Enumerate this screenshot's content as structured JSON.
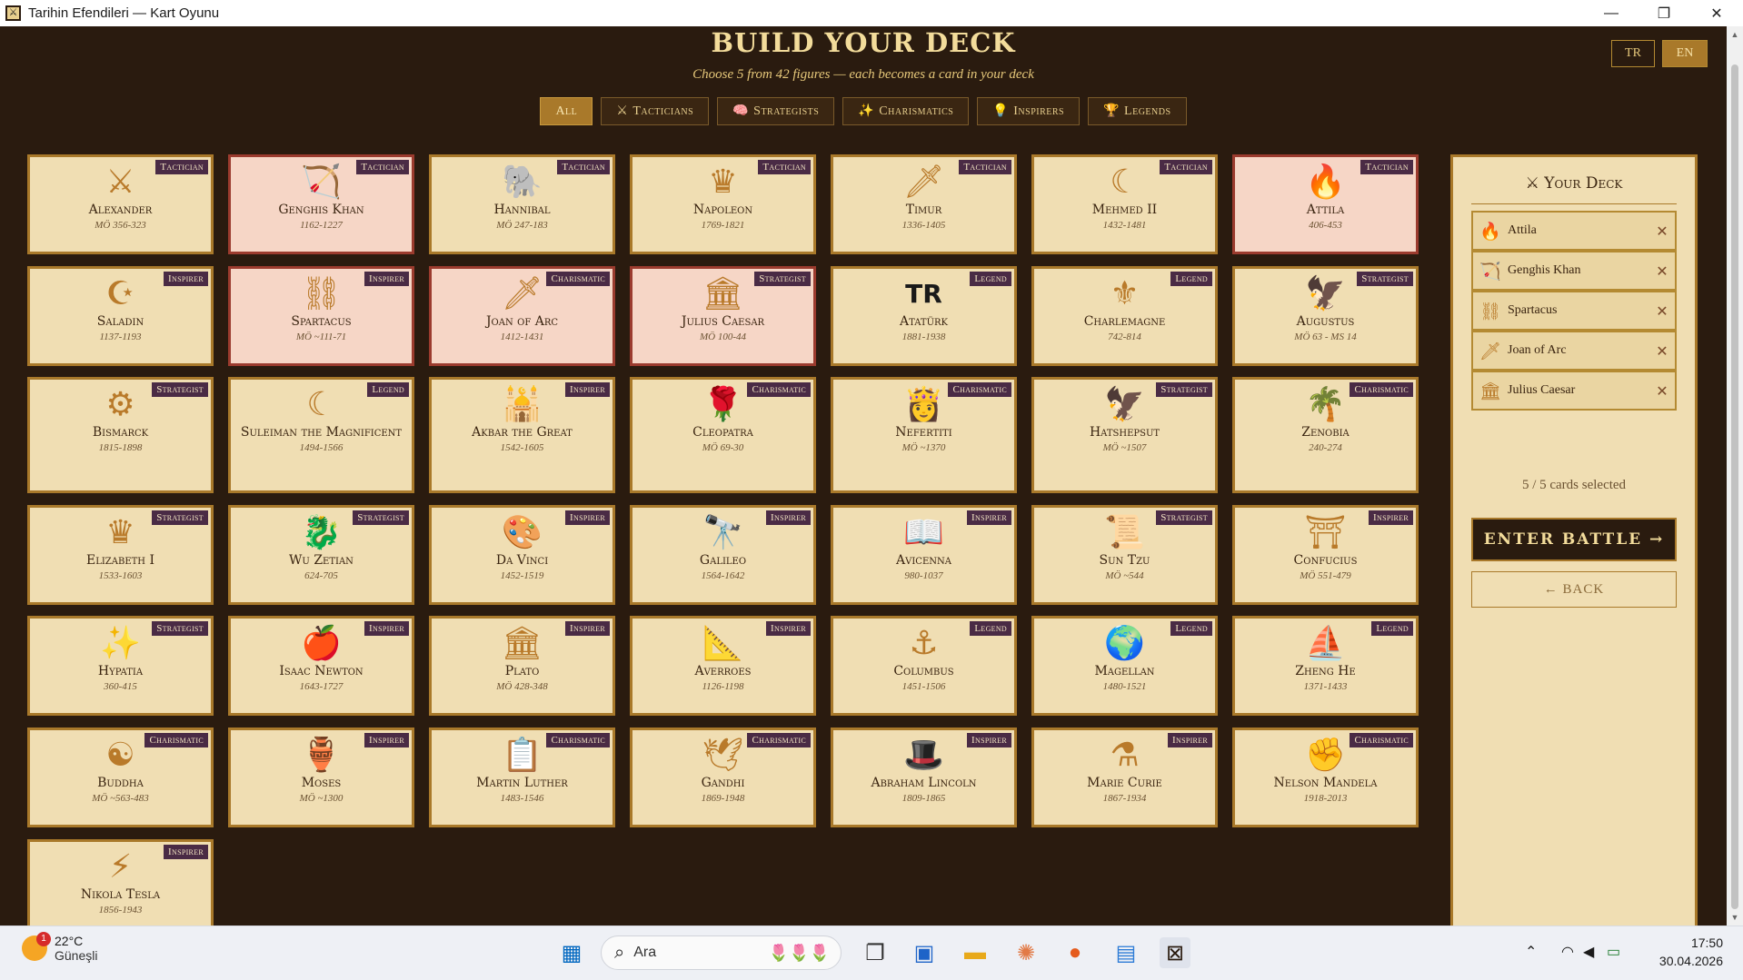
{
  "window": {
    "title": "Tarihin Efendileri — Kart Oyunu",
    "minimize": "—",
    "maximize": "❐",
    "close": "✕"
  },
  "header": {
    "title": "BUILD YOUR DECK",
    "subtitle": "Choose 5 from 42 figures — each becomes a card in your deck",
    "lang_tr": "TR",
    "lang_en": "EN",
    "active_lang": "EN"
  },
  "filters": [
    {
      "icon": "",
      "label": "All",
      "active": true
    },
    {
      "icon": "⚔",
      "label": "Tacticians",
      "active": false
    },
    {
      "icon": "🧠",
      "label": "Strategists",
      "active": false
    },
    {
      "icon": "✨",
      "label": "Charismatics",
      "active": false
    },
    {
      "icon": "💡",
      "label": "Inspirers",
      "active": false
    },
    {
      "icon": "🏆",
      "label": "Legends",
      "active": false
    }
  ],
  "cards": [
    {
      "name": "Alexander",
      "dates": "MÖ 356-323",
      "badge": "Tactician",
      "icon": "⚔",
      "selected": false
    },
    {
      "name": "Genghis Khan",
      "dates": "1162-1227",
      "badge": "Tactician",
      "icon": "🏹",
      "selected": true
    },
    {
      "name": "Hannibal",
      "dates": "MÖ 247-183",
      "badge": "Tactician",
      "icon": "🐘",
      "selected": false
    },
    {
      "name": "Napoleon",
      "dates": "1769-1821",
      "badge": "Tactician",
      "icon": "♛",
      "selected": false
    },
    {
      "name": "Timur",
      "dates": "1336-1405",
      "badge": "Tactician",
      "icon": "🗡",
      "selected": false
    },
    {
      "name": "Mehmed II",
      "dates": "1432-1481",
      "badge": "Tactician",
      "icon": "☾",
      "selected": false
    },
    {
      "name": "Attila",
      "dates": "406-453",
      "badge": "Tactician",
      "icon": "🔥",
      "selected": true
    },
    {
      "name": "Saladin",
      "dates": "1137-1193",
      "badge": "Inspirer",
      "icon": "☪",
      "selected": false
    },
    {
      "name": "Spartacus",
      "dates": "MÖ ~111-71",
      "badge": "Inspirer",
      "icon": "⛓",
      "selected": true
    },
    {
      "name": "Joan of Arc",
      "dates": "1412-1431",
      "badge": "Charismatic",
      "icon": "🗡",
      "selected": true
    },
    {
      "name": "Julius Caesar",
      "dates": "MÖ 100-44",
      "badge": "Strategist",
      "icon": "🏛",
      "selected": true
    },
    {
      "name": "Atatürk",
      "dates": "1881-1938",
      "badge": "Legend",
      "icon": "TR",
      "selected": false
    },
    {
      "name": "Charlemagne",
      "dates": "742-814",
      "badge": "Legend",
      "icon": "⚜",
      "selected": false
    },
    {
      "name": "Augustus",
      "dates": "MÖ 63 - MS 14",
      "badge": "Strategist",
      "icon": "🦅",
      "selected": false
    },
    {
      "name": "Bismarck",
      "dates": "1815-1898",
      "badge": "Strategist",
      "icon": "⚙",
      "selected": false
    },
    {
      "name": "Suleiman the Magnificent",
      "dates": "1494-1566",
      "badge": "Legend",
      "icon": "☾",
      "selected": false
    },
    {
      "name": "Akbar the Great",
      "dates": "1542-1605",
      "badge": "Inspirer",
      "icon": "🕌",
      "selected": false
    },
    {
      "name": "Cleopatra",
      "dates": "MÖ 69-30",
      "badge": "Charismatic",
      "icon": "🌹",
      "selected": false
    },
    {
      "name": "Nefertiti",
      "dates": "MÖ ~1370",
      "badge": "Charismatic",
      "icon": "👸",
      "selected": false
    },
    {
      "name": "Hatshepsut",
      "dates": "MÖ ~1507",
      "badge": "Strategist",
      "icon": "🦅",
      "selected": false
    },
    {
      "name": "Zenobia",
      "dates": "240-274",
      "badge": "Charismatic",
      "icon": "🌴",
      "selected": false
    },
    {
      "name": "Elizabeth I",
      "dates": "1533-1603",
      "badge": "Strategist",
      "icon": "♛",
      "selected": false
    },
    {
      "name": "Wu Zetian",
      "dates": "624-705",
      "badge": "Strategist",
      "icon": "🐉",
      "selected": false
    },
    {
      "name": "Da Vinci",
      "dates": "1452-1519",
      "badge": "Inspirer",
      "icon": "🎨",
      "selected": false
    },
    {
      "name": "Galileo",
      "dates": "1564-1642",
      "badge": "Inspirer",
      "icon": "🔭",
      "selected": false
    },
    {
      "name": "Avicenna",
      "dates": "980-1037",
      "badge": "Inspirer",
      "icon": "📖",
      "selected": false
    },
    {
      "name": "Sun Tzu",
      "dates": "MÖ ~544",
      "badge": "Strategist",
      "icon": "📜",
      "selected": false
    },
    {
      "name": "Confucius",
      "dates": "MÖ 551-479",
      "badge": "Inspirer",
      "icon": "⛩",
      "selected": false
    },
    {
      "name": "Hypatia",
      "dates": "360-415",
      "badge": "Strategist",
      "icon": "✨",
      "selected": false
    },
    {
      "name": "Isaac Newton",
      "dates": "1643-1727",
      "badge": "Inspirer",
      "icon": "🍎",
      "selected": false
    },
    {
      "name": "Plato",
      "dates": "MÖ 428-348",
      "badge": "Inspirer",
      "icon": "🏛",
      "selected": false
    },
    {
      "name": "Averroes",
      "dates": "1126-1198",
      "badge": "Inspirer",
      "icon": "📐",
      "selected": false
    },
    {
      "name": "Columbus",
      "dates": "1451-1506",
      "badge": "Legend",
      "icon": "⚓",
      "selected": false
    },
    {
      "name": "Magellan",
      "dates": "1480-1521",
      "badge": "Legend",
      "icon": "🌍",
      "selected": false
    },
    {
      "name": "Zheng He",
      "dates": "1371-1433",
      "badge": "Legend",
      "icon": "⛵",
      "selected": false
    },
    {
      "name": "Buddha",
      "dates": "MÖ ~563-483",
      "badge": "Charismatic",
      "icon": "☯",
      "selected": false
    },
    {
      "name": "Moses",
      "dates": "MÖ ~1300",
      "badge": "Inspirer",
      "icon": "🏺",
      "selected": false
    },
    {
      "name": "Martin Luther",
      "dates": "1483-1546",
      "badge": "Charismatic",
      "icon": "📋",
      "selected": false
    },
    {
      "name": "Gandhi",
      "dates": "1869-1948",
      "badge": "Charismatic",
      "icon": "🕊",
      "selected": false
    },
    {
      "name": "Abraham Lincoln",
      "dates": "1809-1865",
      "badge": "Inspirer",
      "icon": "🎩",
      "selected": false
    },
    {
      "name": "Marie Curie",
      "dates": "1867-1934",
      "badge": "Inspirer",
      "icon": "⚗",
      "selected": false
    },
    {
      "name": "Nelson Mandela",
      "dates": "1918-2013",
      "badge": "Charismatic",
      "icon": "✊",
      "selected": false
    },
    {
      "name": "Nikola Tesla",
      "dates": "1856-1943",
      "badge": "Inspirer",
      "icon": "⚡",
      "selected": false
    }
  ],
  "deck": {
    "title": "Your Deck",
    "title_icon": "⚔",
    "slots": [
      {
        "icon": "🔥",
        "name": "Attila"
      },
      {
        "icon": "🏹",
        "name": "Genghis Khan"
      },
      {
        "icon": "⛓",
        "name": "Spartacus"
      },
      {
        "icon": "🗡",
        "name": "Joan of Arc"
      },
      {
        "icon": "🏛",
        "name": "Julius Caesar"
      }
    ],
    "remove_icon": "✕",
    "count_text": "5 / 5 cards selected",
    "battle_label": "ENTER BATTLE →",
    "back_label": "← BACK"
  },
  "taskbar": {
    "temperature": "22°C",
    "condition": "Güneşli",
    "notification_count": "1",
    "search_placeholder": "Ara",
    "time": "17:50",
    "date": "30.04.2026"
  },
  "colors": {
    "background": "#2a1b0f",
    "card": "#f0deb3",
    "card_selected": "#f6d6c6",
    "gold": "#a9792a",
    "badge": "#4a2b45"
  }
}
